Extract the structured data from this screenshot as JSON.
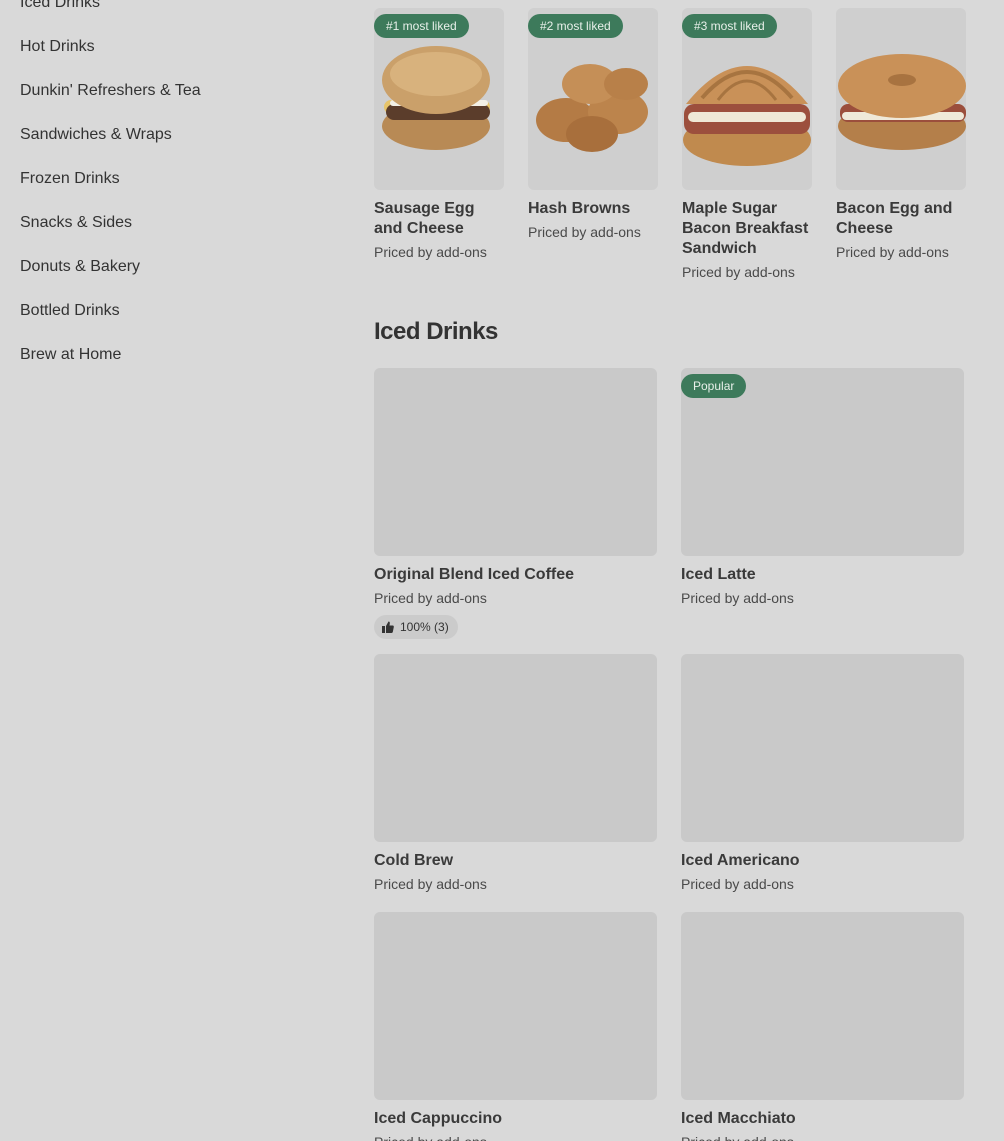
{
  "sidebar": {
    "items": [
      {
        "label": "Iced Drinks"
      },
      {
        "label": "Hot Drinks"
      },
      {
        "label": "Dunkin' Refreshers & Tea"
      },
      {
        "label": "Sandwiches & Wraps"
      },
      {
        "label": "Frozen Drinks"
      },
      {
        "label": "Snacks & Sides"
      },
      {
        "label": "Donuts & Bakery"
      },
      {
        "label": "Bottled Drinks"
      },
      {
        "label": "Brew at Home"
      }
    ]
  },
  "most_liked": [
    {
      "badge": "#1 most liked",
      "name": "Sausage Egg and Cheese",
      "price": "Priced by add-ons"
    },
    {
      "badge": "#2 most liked",
      "name": "Hash Browns",
      "price": "Priced by add-ons"
    },
    {
      "badge": "#3 most liked",
      "name": "Maple Sugar Bacon Breakfast Sandwich",
      "price": "Priced by add-ons"
    },
    {
      "badge": "",
      "name": "Bacon Egg and Cheese",
      "price": "Priced by add-ons"
    }
  ],
  "iced_drinks": {
    "title": "Iced Drinks",
    "items": [
      {
        "name": "Original Blend Iced Coffee",
        "price": "Priced by add-ons",
        "rating": "100% (3)"
      },
      {
        "name": "Iced Latte",
        "price": "Priced by add-ons",
        "badge": "Popular"
      },
      {
        "name": "Cold Brew",
        "price": "Priced by add-ons"
      },
      {
        "name": "Iced Americano",
        "price": "Priced by add-ons"
      },
      {
        "name": "Iced Cappuccino",
        "price": "Priced by add-ons"
      },
      {
        "name": "Iced Macchiato",
        "price": "Priced by add-ons"
      }
    ]
  },
  "colors": {
    "background": "#d9d9d9",
    "badge": "#3d7a5b",
    "image_placeholder": "#c9c9c9"
  },
  "icons": {
    "rating": "thumbs-up-icon"
  }
}
